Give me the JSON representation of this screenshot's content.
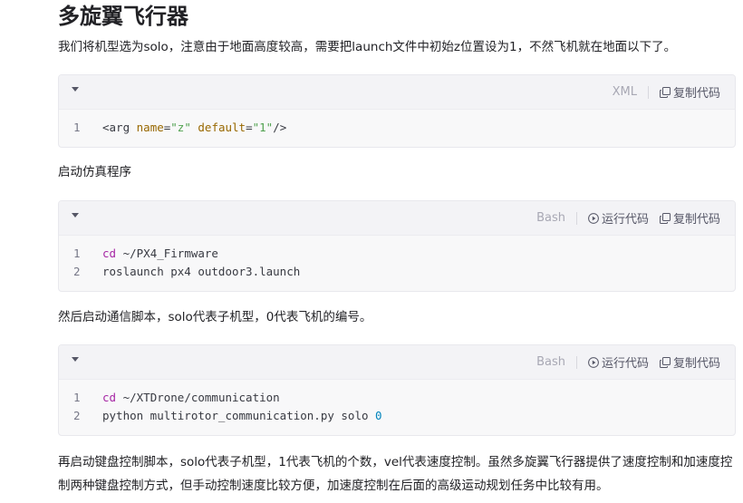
{
  "article": {
    "heading": "多旋翼飞行器",
    "intro": "我们将机型选为solo，注意由于地面高度较高，需要把launch文件中初始z位置设为1，不然飞机就在地面以下了。",
    "p_start_sim": "启动仿真程序",
    "p_comm": "然后启动通信脚本，solo代表子机型，0代表飞机的编号。",
    "p_keyboard": "再启动键盘控制脚本，solo代表子机型，1代表飞机的个数，vel代表速度控制。虽然多旋翼飞行器提供了速度控制和加速度控制两种键盘控制方式，但手动控制速度比较方便，加速度控制在后面的高级运动规划任务中比较有用。"
  },
  "code_blocks": [
    {
      "lang": "XML",
      "copy_label": "复制代码",
      "lines": [
        {
          "n": "1",
          "parts": [
            {
              "t": "<",
              "c": "tag"
            },
            {
              "t": "arg",
              "c": "tag"
            },
            {
              "t": " ",
              "c": ""
            },
            {
              "t": "name",
              "c": "attr"
            },
            {
              "t": "=",
              "c": ""
            },
            {
              "t": "\"z\"",
              "c": "str"
            },
            {
              "t": " ",
              "c": ""
            },
            {
              "t": "default",
              "c": "attr"
            },
            {
              "t": "=",
              "c": ""
            },
            {
              "t": "\"1\"",
              "c": "str"
            },
            {
              "t": "/>",
              "c": "tag"
            }
          ]
        }
      ]
    },
    {
      "lang": "Bash",
      "run_label": "运行代码",
      "copy_label": "复制代码",
      "lines": [
        {
          "n": "1",
          "parts": [
            {
              "t": "cd",
              "c": "kw"
            },
            {
              "t": " ~/PX4_Firmware",
              "c": ""
            }
          ]
        },
        {
          "n": "2",
          "parts": [
            {
              "t": "roslaunch px4 outdoor3.launch",
              "c": ""
            }
          ]
        }
      ]
    },
    {
      "lang": "Bash",
      "run_label": "运行代码",
      "copy_label": "复制代码",
      "lines": [
        {
          "n": "1",
          "parts": [
            {
              "t": "cd",
              "c": "kw"
            },
            {
              "t": " ~/XTDrone/communication",
              "c": ""
            }
          ]
        },
        {
          "n": "2",
          "parts": [
            {
              "t": "python multirotor_communication.py solo ",
              "c": ""
            },
            {
              "t": "0",
              "c": "num"
            }
          ]
        }
      ]
    }
  ],
  "colors": {
    "keyword": "#a626a4",
    "attribute": "#986801",
    "string": "#50a14f",
    "number": "#0184bc"
  },
  "icons": {
    "collapse": "caret-down-icon",
    "copy": "copy-icon",
    "run": "play-circle-icon"
  }
}
